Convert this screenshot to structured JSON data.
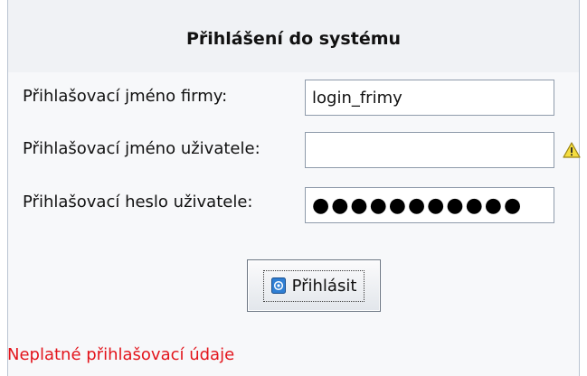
{
  "dialog": {
    "title": "Přihlášení do systému"
  },
  "form": {
    "company_label": "Přihlašovací jméno firmy:",
    "company_value": "login_frimy",
    "user_label": "Přihlašovací jméno uživatele:",
    "user_value": "",
    "password_label": "Přihlašovací heslo uživatele:",
    "password_value": "●●●●●●●●●●●"
  },
  "icons": {
    "user_field_status": "warning-icon",
    "login_button": "login-key-icon"
  },
  "actions": {
    "login_label": "Přihlásit"
  },
  "status": {
    "error_message": "Neplatné přihlašovací údaje",
    "error_color": "#e3141b"
  }
}
